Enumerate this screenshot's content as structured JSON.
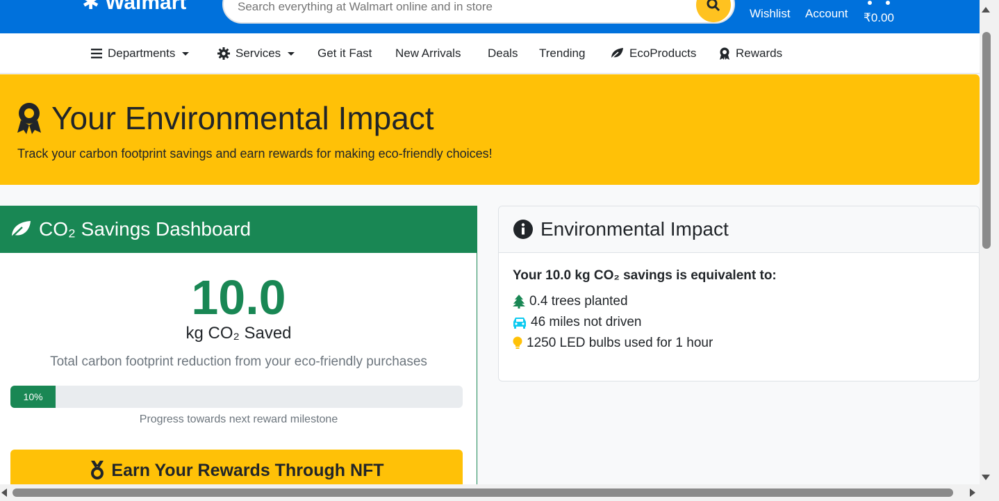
{
  "header": {
    "logo_text": "Walmart",
    "search_placeholder": "Search everything at Walmart online and in store",
    "wishlist": "Wishlist",
    "account": "Account",
    "cart_total": "₹0.00"
  },
  "nav": {
    "items": [
      {
        "label": "Departments",
        "icon": "bars-icon",
        "dropdown": true
      },
      {
        "label": "Services",
        "icon": "gear-icon",
        "dropdown": true
      },
      {
        "label": "Get it Fast"
      },
      {
        "label": "New Arrivals"
      },
      {
        "label": "Deals"
      },
      {
        "label": "Trending"
      },
      {
        "label": "EcoProducts",
        "icon": "leaf-icon"
      },
      {
        "label": "Rewards",
        "icon": "award-icon"
      }
    ]
  },
  "hero": {
    "title": "Your Environmental Impact",
    "subtitle": "Track your carbon footprint savings and earn rewards for making eco-friendly choices!"
  },
  "dashboard": {
    "title": "CO₂ Savings Dashboard",
    "value": "10.0",
    "unit": "kg CO₂ Saved",
    "description": "Total carbon footprint reduction from your eco-friendly purchases",
    "progress_label": "10%",
    "progress_value": 0.1,
    "progress_caption": "Progress towards next reward milestone",
    "nft_button": "Earn Your Rewards Through NFT"
  },
  "impact": {
    "title": "Environmental Impact",
    "equivalent_title": "Your 10.0 kg CO₂ savings is equivalent to:",
    "items": [
      {
        "icon": "tree-icon",
        "text": "0.4 trees planted",
        "color": "#198754"
      },
      {
        "icon": "car-icon",
        "text": "46 miles not driven",
        "color": "#0dcaf0"
      },
      {
        "icon": "lightbulb-icon",
        "text": "1250 LED bulbs used for 1 hour",
        "color": "#ffc107"
      }
    ]
  },
  "colors": {
    "brand_blue": "#0071dc",
    "accent_yellow": "#ffc107",
    "eco_green": "#198754"
  }
}
